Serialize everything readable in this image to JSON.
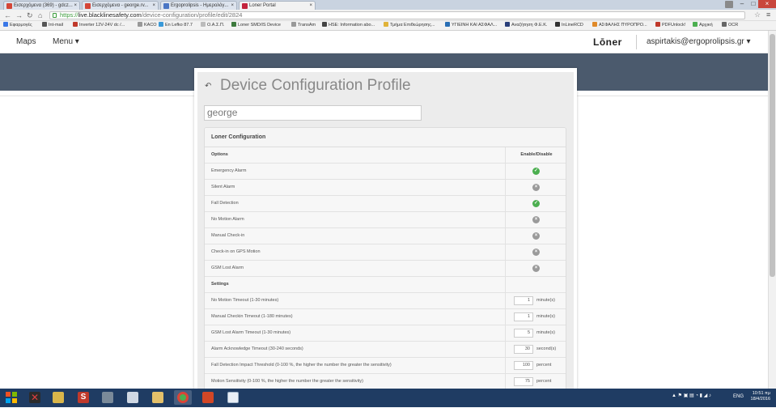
{
  "browser": {
    "tabs": [
      {
        "label": "Εισερχόμενα (369) - gdcz...",
        "favicon_color": "#d44638",
        "active": false
      },
      {
        "label": "Εισερχόμενα - george.rv...",
        "favicon_color": "#d44638",
        "active": false
      },
      {
        "label": "Ergoprolipsis - Ημερολόγ...",
        "favicon_color": "#4a76c4",
        "active": false
      },
      {
        "label": "Loner Portal",
        "favicon_color": "#c3243d",
        "active": true
      }
    ],
    "url_scheme": "https://",
    "url_host": "live.blacklinesafety.com",
    "url_path": "/device-configuration/profile/edit/2824",
    "bookmarks": [
      {
        "label": "Εφαρμογές",
        "color": "#3b78e7"
      },
      {
        "label": "Int-mail",
        "color": "#555555"
      },
      {
        "label": "Inverter 12V-24V dc /...",
        "color": "#c0392b"
      },
      {
        "label": "KACO",
        "color": "#999999"
      },
      {
        "label": "En Lefko 87.7",
        "color": "#3a9ad9"
      },
      {
        "label": "Ο.Α.Σ.Π.",
        "color": "#bbbbbb"
      },
      {
        "label": "Loner SMD/IS Device",
        "color": "#3d7a3d"
      },
      {
        "label": "TransAm",
        "color": "#999999"
      },
      {
        "label": "HSE: Information abo...",
        "color": "#444444"
      },
      {
        "label": "Τμήμα Επιθεώρησης...",
        "color": "#e0b33a"
      },
      {
        "label": "ΥΓΙΕΙΝΗ ΚΑΙ ΑΣΦΑΛ...",
        "color": "#2a6fb5"
      },
      {
        "label": "Αναζήτηση Φ.Ε.Κ.",
        "color": "#2a3f7a"
      },
      {
        "label": "InLineRCD",
        "color": "#333333"
      },
      {
        "label": "ΑΣΦΑΛΗΣ ΠΥΡΟΠΡΟ...",
        "color": "#e08a2a"
      },
      {
        "label": "PDFUnlock!",
        "color": "#c0392b"
      },
      {
        "label": "Αρχική",
        "color": "#4caf50"
      },
      {
        "label": "OCR",
        "color": "#666666"
      }
    ]
  },
  "app": {
    "nav": {
      "maps": "Maps",
      "menu": "Menu ▾",
      "logo": "Lōner",
      "account": "aspirtakis@ergoprolipsis.gr ▾"
    },
    "page_title": "Device Configuration Profile",
    "profile_name": "george",
    "panel_title": "Loner Configuration",
    "options_header": "Options",
    "enable_header": "Enable/Disable",
    "options": [
      {
        "label": "Emergency Alarm",
        "enabled": true
      },
      {
        "label": "Silent Alarm",
        "enabled": false
      },
      {
        "label": "Fall Detection",
        "enabled": true
      },
      {
        "label": "No Motion Alarm",
        "enabled": false
      },
      {
        "label": "Manual Check-in",
        "enabled": false
      },
      {
        "label": "Check-in on GPS Motion",
        "enabled": false
      },
      {
        "label": "GSM Lost Alarm",
        "enabled": false
      }
    ],
    "settings_header": "Settings",
    "settings": [
      {
        "label": "No Motion Timeout (1-30 minutes)",
        "value": "1",
        "unit": "minute(s)"
      },
      {
        "label": "Manual Checkin Timeout (1-180 minutes)",
        "value": "1",
        "unit": "minute(s)"
      },
      {
        "label": "GSM Lost Alarm Timeout (1-30 minutes)",
        "value": "5",
        "unit": "minute(s)"
      },
      {
        "label": "Alarm Acknowledge Timeout (30-240 seconds)",
        "value": "30",
        "unit": "second(s)"
      },
      {
        "label": "Fall Detection Impact Threshold (0-100 %, the higher the number the greater the sensitivity)",
        "value": "100",
        "unit": "percent"
      },
      {
        "label": "Motion Sensitivity (0-100 %, the higher the number the greater the sensitivity)",
        "value": "75",
        "unit": "percent"
      }
    ]
  },
  "taskbar": {
    "lang": "ENG",
    "time": "10:51 πμ",
    "date": "18/4/2016"
  },
  "colors": {
    "nav_banner": "#4b5a6d",
    "enabled": "#4caf50",
    "disabled": "#9a9a9a",
    "taskbar": "#1f3c63"
  }
}
